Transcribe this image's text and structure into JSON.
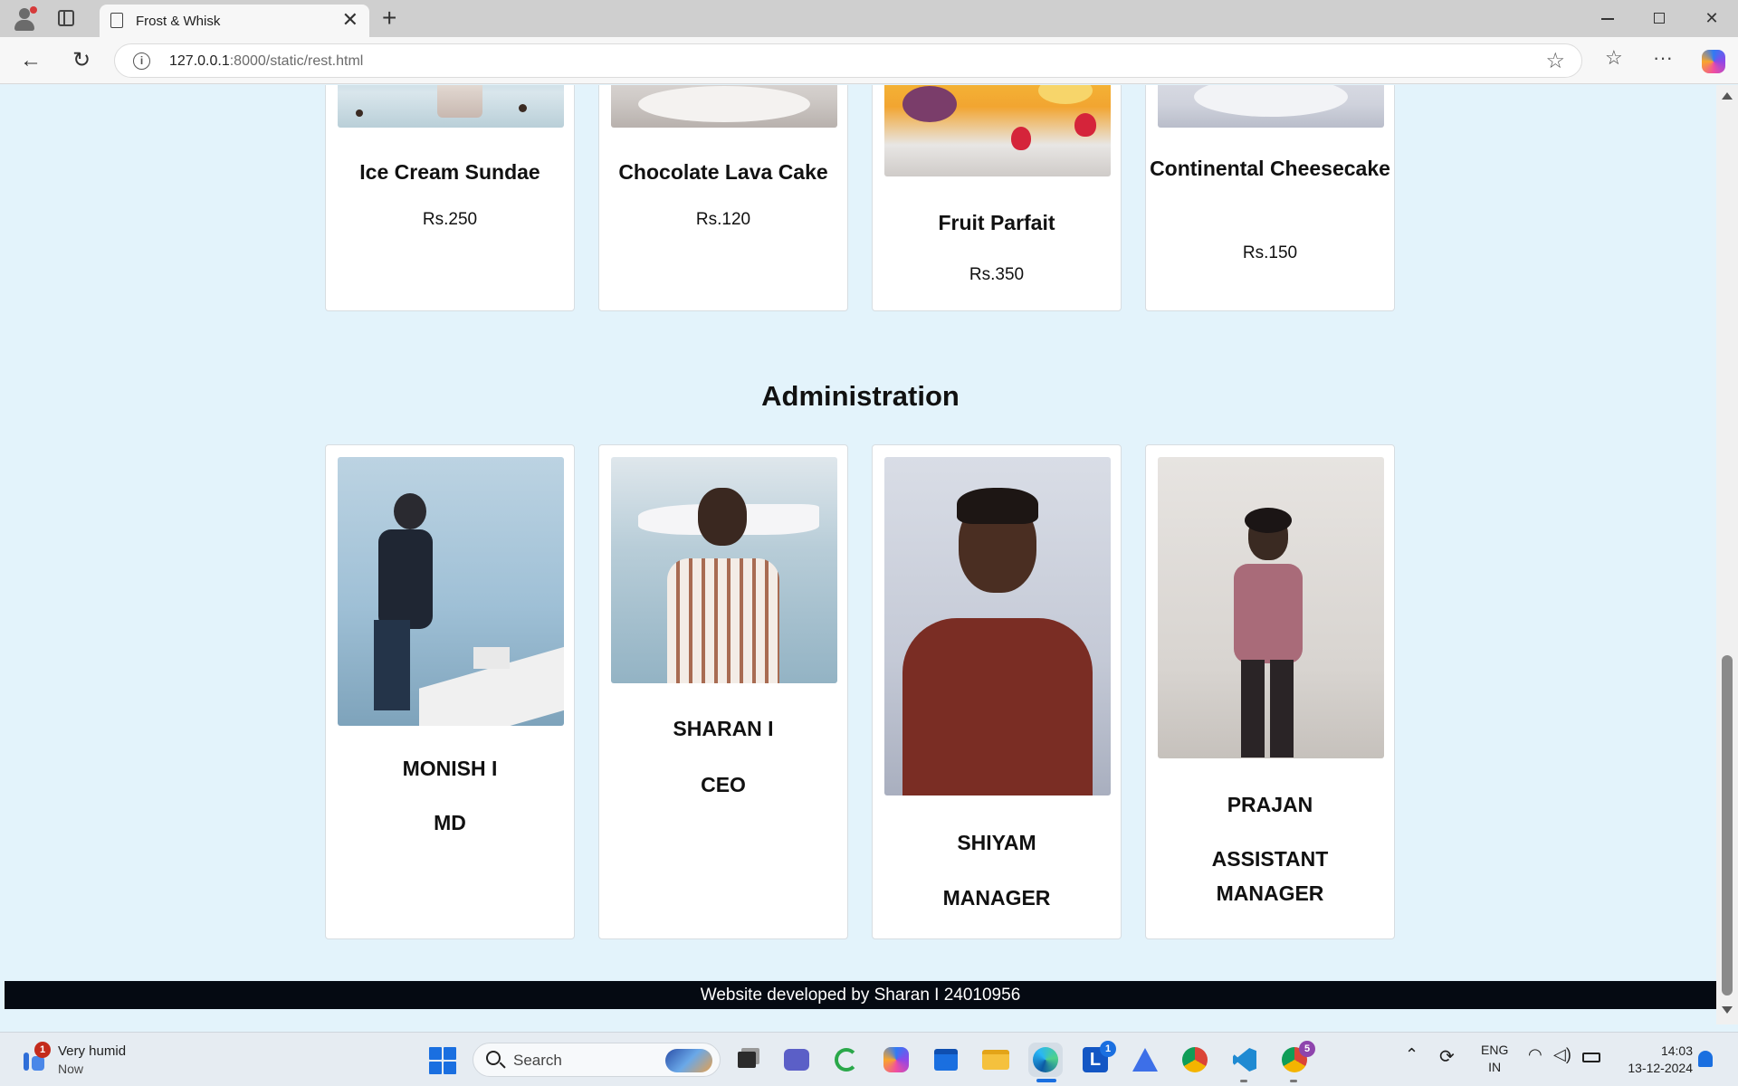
{
  "browser": {
    "tab_title": "Frost & Whisk",
    "tab_close": "✕",
    "new_tab": "+",
    "url_host": "127.0.0.1",
    "url_path": ":8000/static/rest.html",
    "window_minimize": "—",
    "window_restore": "❐",
    "window_close": "✕"
  },
  "desserts": [
    {
      "name": "Ice Cream Sundae",
      "price": "Rs.250"
    },
    {
      "name": "Chocolate Lava Cake",
      "price": "Rs.120"
    },
    {
      "name": "Fruit Parfait",
      "price": "Rs.350"
    },
    {
      "name": "Continental Cheesecake",
      "price": "Rs.150"
    }
  ],
  "administration": {
    "title": "Administration",
    "members": [
      {
        "name": "MONISH I",
        "role": "MD"
      },
      {
        "name": "SHARAN I",
        "role": "CEO"
      },
      {
        "name": "SHIYAM",
        "role": "MANAGER"
      },
      {
        "name": "PRAJAN",
        "role": "ASSISTANT MANAGER"
      }
    ]
  },
  "footer": {
    "text": "Website developed by Sharan I 24010956"
  },
  "taskbar": {
    "weather_title": "Very humid",
    "weather_sub": "Now",
    "weather_badge": "1",
    "search_placeholder": "Search",
    "outlook_badge": "1",
    "chrome_badge": "5",
    "lang_top": "ENG",
    "lang_bottom": "IN",
    "time": "14:03",
    "date": "13-12-2024"
  },
  "icons": [
    "profile-icon",
    "tabs-icon",
    "page-icon",
    "back-icon",
    "refresh-icon",
    "info-icon",
    "favorite-star-icon",
    "favorites-icon",
    "more-icon",
    "copilot-icon",
    "start-icon",
    "search-icon",
    "file-explorer-icon",
    "teams-icon",
    "edge-icon",
    "vscode-icon",
    "chrome-icon",
    "wifi-icon",
    "volume-icon",
    "battery-icon",
    "bell-icon"
  ]
}
